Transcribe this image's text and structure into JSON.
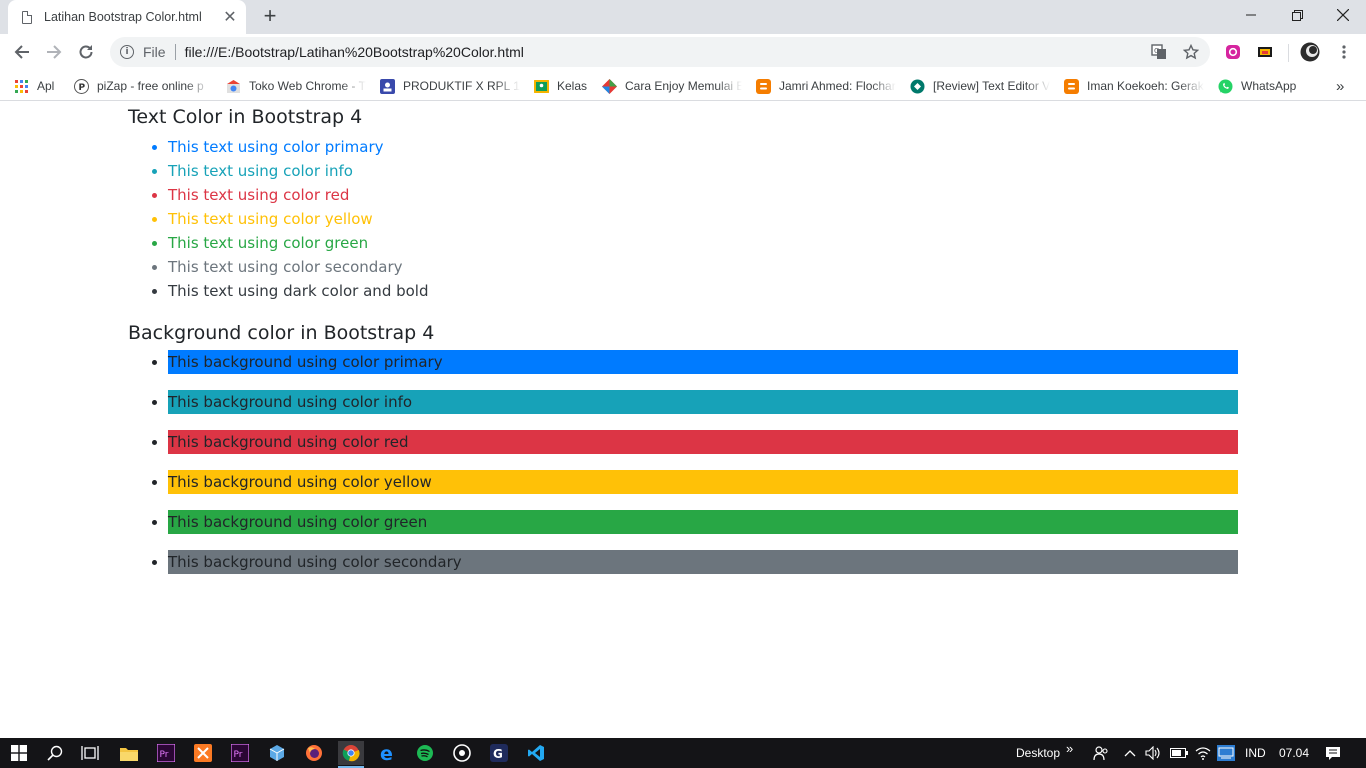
{
  "browser": {
    "tab_title": "Latihan Bootstrap Color.html",
    "tab_close": "✕",
    "new_tab": "+",
    "window": {
      "minimize": "—",
      "maximize": "❐",
      "close": "✕"
    },
    "address": {
      "scheme": "File",
      "url": "file:///E:/Bootstrap/Latihan%20Bootstrap%20Color.html"
    },
    "bookmarks": [
      {
        "label": "Apl",
        "icon": "apps-grid-icon"
      },
      {
        "label": "piZap - free online p",
        "icon": "pizap-icon"
      },
      {
        "label": "Toko Web Chrome - T",
        "icon": "chrome-webstore-icon"
      },
      {
        "label": "PRODUKTIF X RPL 1 -",
        "icon": "classroom-icon"
      },
      {
        "label": "Kelas",
        "icon": "google-classroom-icon"
      },
      {
        "label": "Cara Enjoy Memulai E",
        "icon": "site-icon"
      },
      {
        "label": "Jamri Ahmed: Flochar",
        "icon": "blogger-icon"
      },
      {
        "label": "[Review] Text Editor V",
        "icon": "site-icon"
      },
      {
        "label": "Iman Koekoeh: Gerak",
        "icon": "blogger-icon"
      },
      {
        "label": "WhatsApp",
        "icon": "whatsapp-icon"
      }
    ],
    "bookmarks_overflow": "»"
  },
  "page": {
    "text_heading": "Text Color in Bootstrap 4",
    "text_items": [
      {
        "label": "This text using color primary",
        "color": "#007bff",
        "bullet": "#007bff"
      },
      {
        "label": "This text using color info",
        "color": "#17a2b8",
        "bullet": "#17a2b8"
      },
      {
        "label": "This text using color red",
        "color": "#dc3545",
        "bullet": "#dc3545"
      },
      {
        "label": "This text using color yellow",
        "color": "#ffc107",
        "bullet": "#ffc107"
      },
      {
        "label": "This text using color green",
        "color": "#28a745",
        "bullet": "#28a745"
      },
      {
        "label": "This text using color secondary",
        "color": "#6c757d",
        "bullet": "#6c757d"
      },
      {
        "label": "This text using dark color and bold",
        "color": "#343a40",
        "bullet": "#212529"
      }
    ],
    "bg_heading": "Background color in Bootstrap 4",
    "bg_items": [
      {
        "label": "This background using color primary",
        "bg": "#007bff"
      },
      {
        "label": "This background using color info",
        "bg": "#17a2b8"
      },
      {
        "label": "This background using color red",
        "bg": "#dc3545"
      },
      {
        "label": "This background using color yellow",
        "bg": "#ffc107"
      },
      {
        "label": "This background using color green",
        "bg": "#28a745"
      },
      {
        "label": "This background using color secondary",
        "bg": "#6c757d"
      }
    ]
  },
  "taskbar": {
    "desktop_label": "Desktop",
    "desktop_chevron": "»",
    "language": "IND",
    "time": "07.04"
  }
}
